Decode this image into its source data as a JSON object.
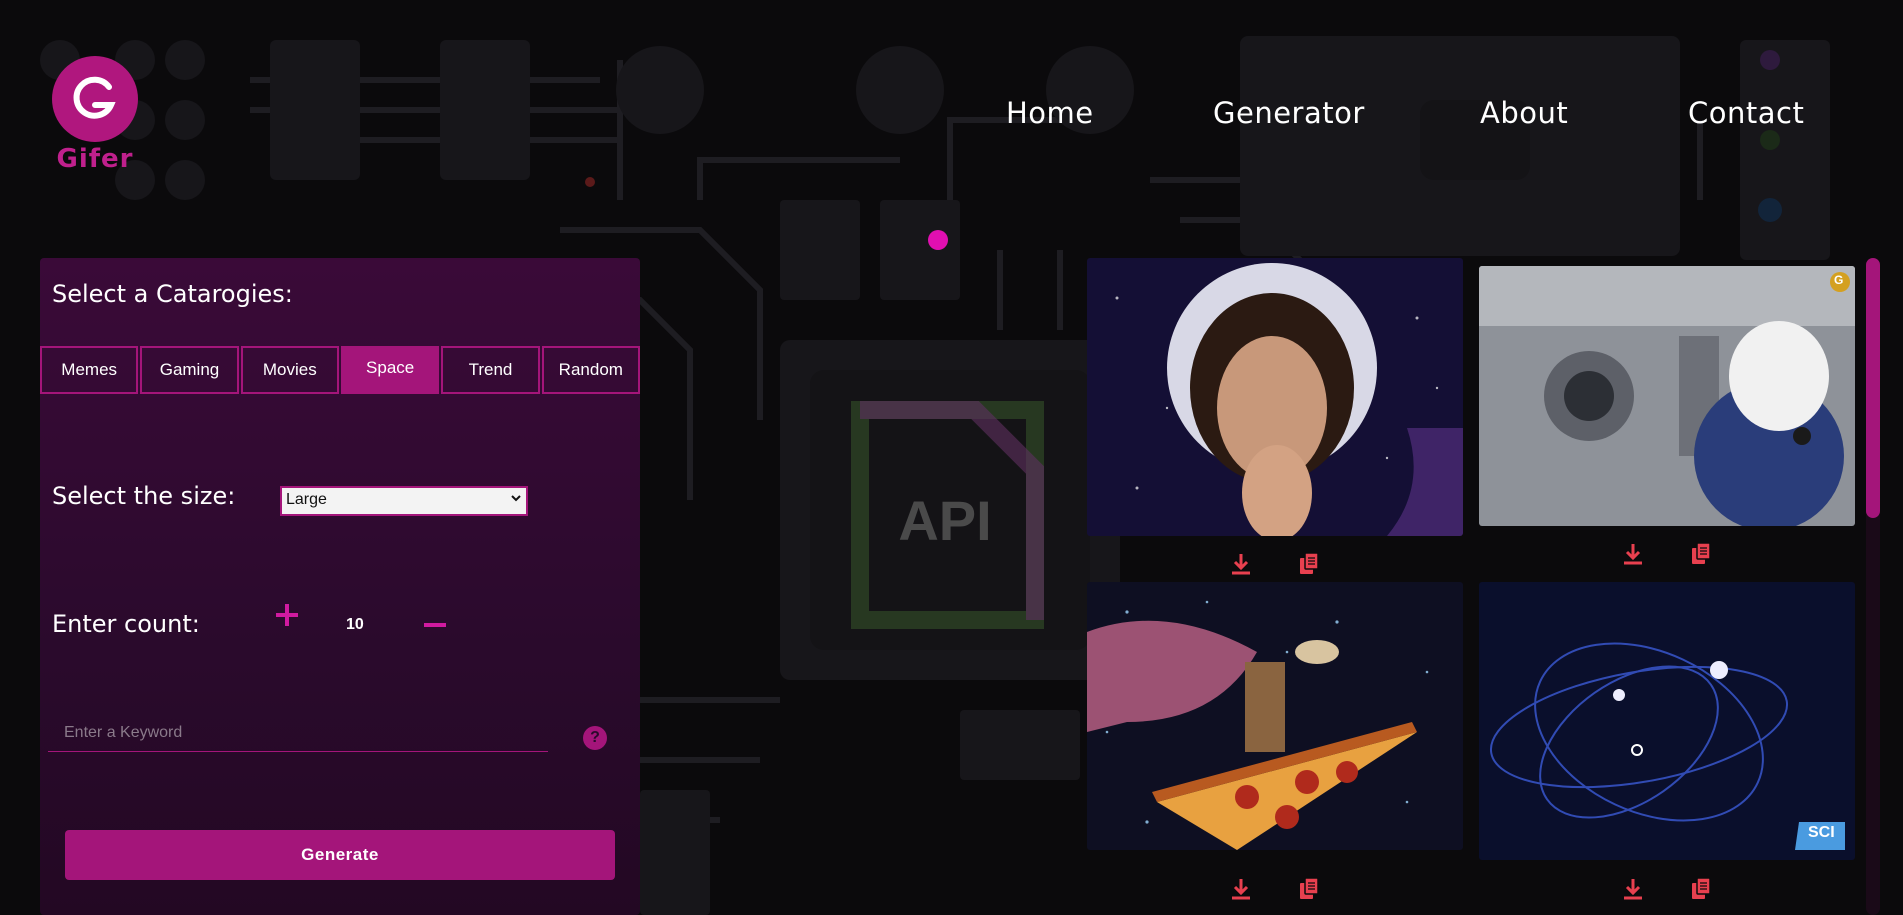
{
  "brand": {
    "name": "Gifer",
    "logo_letter": "G"
  },
  "nav": {
    "items": [
      "Home",
      "Generator",
      "About",
      "Contact"
    ]
  },
  "panel": {
    "categories_title": "Select a Catarogies:",
    "categories": [
      "Memes",
      "Gaming",
      "Movies",
      "Space",
      "Trend",
      "Random"
    ],
    "active_category": "Space",
    "size_label": "Select the size:",
    "size_value": "Large",
    "count_label": "Enter count:",
    "count_value": "10",
    "keyword_placeholder": "Enter a Keyword",
    "help_symbol": "?",
    "generate_label": "Generate"
  },
  "background": {
    "chip_text": "API"
  },
  "gifs": [
    {
      "scene": "man-blowing-kiss-in-space",
      "icons": [
        "download-icon",
        "copy-icon"
      ]
    },
    {
      "scene": "dog-astronaut-in-space-station",
      "corner_badge": "G",
      "icons": [
        "download-icon",
        "copy-icon"
      ]
    },
    {
      "scene": "cowboy-riding-pizza-in-space",
      "icons": [
        "download-icon",
        "copy-icon"
      ]
    },
    {
      "scene": "orbits-animation",
      "badge": "SCI",
      "icons": [
        "download-icon",
        "copy-icon"
      ]
    }
  ],
  "colors": {
    "accent": "#a4157a",
    "accent_bright": "#e10fb1",
    "icon": "#e8404f",
    "bg": "#0b0a0c"
  }
}
